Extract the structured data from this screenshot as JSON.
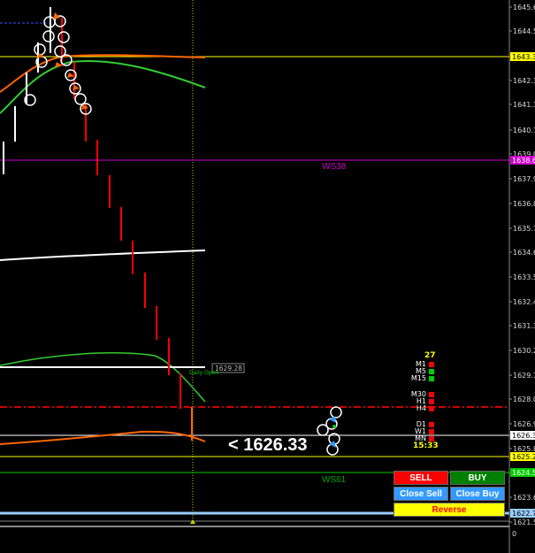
{
  "chart": {
    "accent_colors": {
      "sell": "#ff0000",
      "buy": "#008000",
      "close": "#3399ff",
      "reverse": "#ffff00"
    },
    "axis_ticks": [
      "1645.6",
      "1644.5",
      "1643.3",
      "1642.3",
      "1641.3",
      "1640.1",
      "1639.0",
      "1637.9",
      "1636.8",
      "1635.7",
      "1634.6",
      "1633.5",
      "1632.4",
      "1631.3",
      "1630.2",
      "1629.1",
      "1628.0",
      "1626.9",
      "1626.3",
      "1625.8",
      "1625.2",
      "1624.5",
      "1623.6",
      "1622.7",
      "1621.5"
    ],
    "price_labels": [
      {
        "text": "1643.3",
        "color": "#ffff00",
        "key": "yellow-top"
      },
      {
        "text": "1638.6",
        "color": "#cc00cc",
        "key": "magenta"
      },
      {
        "text": "1626.3",
        "color": "#ffffff",
        "key": "white"
      },
      {
        "text": "1625.2",
        "color": "#ffff00",
        "key": "yellow-low"
      },
      {
        "text": "1624.5",
        "color": "#00cc00",
        "key": "green"
      },
      {
        "text": "1622.7",
        "color": "#99ccff",
        "key": "lightblue"
      }
    ],
    "axis_bottom": "0",
    "line_labels": {
      "ws38": "WS38",
      "ws61": "WS61"
    },
    "marker_box": "1629.28",
    "daily_open": "Daily Open",
    "current_price": "<  1626.33"
  },
  "hud": {
    "count": "27",
    "groups": [
      [
        {
          "tf": "M1",
          "color": "#ff0000"
        },
        {
          "tf": "M5",
          "color": "#00cc00"
        },
        {
          "tf": "M15",
          "color": "#00cc00"
        }
      ],
      [
        {
          "tf": "M30",
          "color": "#ff0000"
        },
        {
          "tf": "H1",
          "color": "#ff0000"
        },
        {
          "tf": "H4",
          "color": "#ff0000"
        }
      ],
      [
        {
          "tf": "D1",
          "color": "#ff0000"
        },
        {
          "tf": "W1",
          "color": "#ff0000"
        },
        {
          "tf": "MN",
          "color": "#ff0000"
        }
      ]
    ],
    "time": "15:33"
  },
  "panel": {
    "sell": "SELL",
    "buy": "BUY",
    "close_sell": "Close Sell",
    "close_buy": "Close Buy",
    "reverse": "Reverse"
  }
}
